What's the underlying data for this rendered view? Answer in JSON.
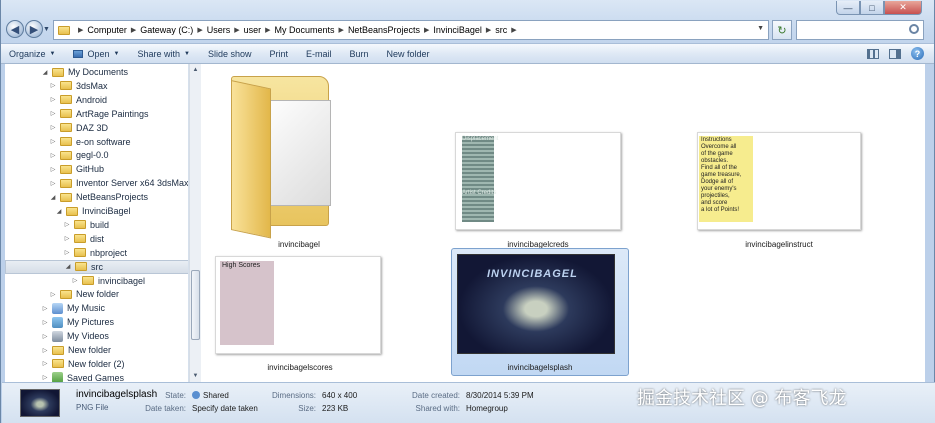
{
  "window": {
    "caption_buttons": {
      "minimize": "—",
      "maximize": "□",
      "close": "✕"
    }
  },
  "nav": {
    "back_glyph": "◀",
    "forward_glyph": "▶",
    "recent_glyph": "▼",
    "refresh_glyph": "↻"
  },
  "address": {
    "crumbs": [
      "Computer",
      "Gateway (C:)",
      "Users",
      "user",
      "My Documents",
      "NetBeansProjects",
      "InvinciBagel",
      "src"
    ],
    "separator": "▶",
    "dropdown_glyph": "▼"
  },
  "search": {
    "placeholder": ""
  },
  "toolbar": {
    "organize": "Organize",
    "open": "Open",
    "share_with": "Share with",
    "slide_show": "Slide show",
    "print": "Print",
    "email": "E-mail",
    "burn": "Burn",
    "new_folder": "New folder",
    "caret": "▼",
    "help": "?"
  },
  "tree": [
    {
      "label": "My Documents",
      "expanded": true
    },
    {
      "label": "3dsMax",
      "expanded": false
    },
    {
      "label": "Android",
      "expanded": false
    },
    {
      "label": "ArtRage Paintings",
      "expanded": false
    },
    {
      "label": "DAZ 3D",
      "expanded": false
    },
    {
      "label": "e-on software",
      "expanded": false
    },
    {
      "label": "gegl-0.0",
      "expanded": false
    },
    {
      "label": "GitHub",
      "expanded": false
    },
    {
      "label": "Inventor Server x64 3dsMax",
      "expanded": false
    },
    {
      "label": "NetBeansProjects",
      "expanded": true
    },
    {
      "label": "InvinciBagel",
      "expanded": true
    },
    {
      "label": "build",
      "expanded": false
    },
    {
      "label": "dist",
      "expanded": false
    },
    {
      "label": "nbproject",
      "expanded": false
    },
    {
      "label": "src",
      "expanded": true,
      "selected": true
    },
    {
      "label": "invincibagel",
      "expanded": false
    },
    {
      "label": "New folder",
      "expanded": false
    },
    {
      "label": "My Music",
      "expanded": false
    },
    {
      "label": "My Pictures",
      "expanded": false
    },
    {
      "label": "My Videos",
      "expanded": false
    },
    {
      "label": "New folder",
      "expanded": false
    },
    {
      "label": "New folder (2)",
      "expanded": false
    },
    {
      "label": "Saved Games",
      "expanded": false
    }
  ],
  "tree_glyphs": {
    "expanded": "◢",
    "collapsed": "▷"
  },
  "files": [
    {
      "name": "invincibagel",
      "kind": "folder"
    },
    {
      "name": "invincibagelcreds",
      "kind": "image",
      "preview_text": [
        "Displacement",
        "Artist Credits"
      ]
    },
    {
      "name": "invincibagelinstruct",
      "kind": "image",
      "preview_text": [
        "Instructions",
        "Overcome all",
        "of the game",
        "obstacles.",
        "Find all of the",
        "game treasure,",
        "Dodge all of",
        "your enemy's",
        "projectiles,",
        "and score",
        "a lot of Points!"
      ]
    },
    {
      "name": "invincibagelscores",
      "kind": "image",
      "preview_text": [
        "High Scores"
      ]
    },
    {
      "name": "invincibagelsplash",
      "kind": "image",
      "selected": true,
      "preview_text": [
        "INVINCIBAGEL"
      ]
    }
  ],
  "details": {
    "name": "invincibagelsplash",
    "type": "PNG File",
    "state_label": "State:",
    "state_value": "Shared",
    "date_taken_label": "Date taken:",
    "date_taken_value": "Specify date taken",
    "dimensions_label": "Dimensions:",
    "dimensions_value": "640 x 400",
    "size_label": "Size:",
    "size_value": "223 KB",
    "date_created_label": "Date created:",
    "date_created_value": "8/30/2014 5:39 PM",
    "shared_with_label": "Shared with:",
    "shared_with_value": "Homegroup"
  },
  "watermark": "掘金技术社区 @ 布客飞龙",
  "colors": {
    "selection": "#c1d8f3",
    "toolbar": "#dfe9f5",
    "folder": "#e8c04f"
  }
}
